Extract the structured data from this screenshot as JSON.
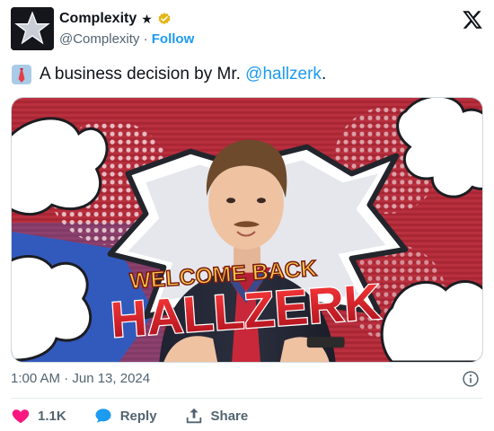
{
  "author": {
    "display_name": "Complexity",
    "star": "★",
    "handle": "@Complexity",
    "separator": "·",
    "follow_label": "Follow",
    "verified_color": "#e2b719"
  },
  "tweet": {
    "emoji": "tie-emoji",
    "text_before": "A business decision by Mr. ",
    "mention": "@hallzerk",
    "text_after": "."
  },
  "media": {
    "line1": "WELCOME BACK",
    "line2": "HALLZERK"
  },
  "meta": {
    "timestamp": "1:00 AM · Jun 13, 2024"
  },
  "actions": {
    "like_count": "1.1K",
    "reply_label": "Reply",
    "share_label": "Share"
  },
  "colors": {
    "accent": "#1d9bf0",
    "like": "#f91880",
    "text_secondary": "#536471"
  }
}
